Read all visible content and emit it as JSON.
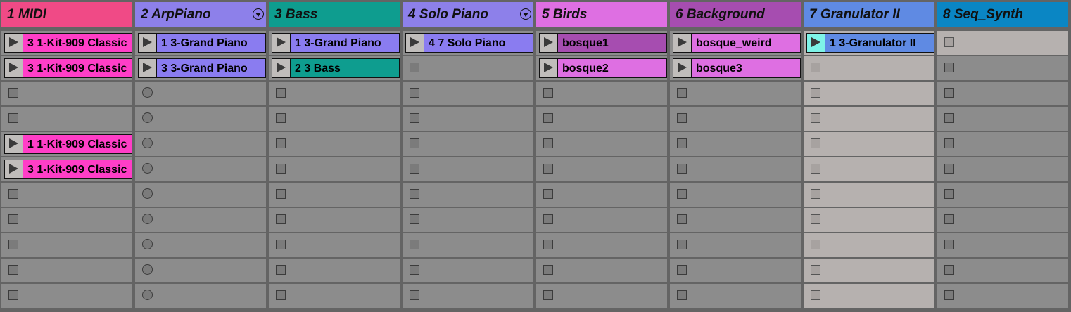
{
  "session": {
    "tracks": [
      {
        "name": "1 MIDI",
        "color": "#f04a86",
        "slot_bg": "dark",
        "fold_icon": false,
        "slots": [
          {
            "kind": "clip",
            "name": "3 1-Kit-909 Classic",
            "color": "#ff3ec7"
          },
          {
            "kind": "clip",
            "name": "3 1-Kit-909 Classic",
            "color": "#ff3ec7"
          },
          {
            "kind": "stop"
          },
          {
            "kind": "stop"
          },
          {
            "kind": "clip",
            "name": "1 1-Kit-909 Classic",
            "color": "#ff3ec7"
          },
          {
            "kind": "clip",
            "name": "3 1-Kit-909 Classic",
            "color": "#ff3ec7"
          },
          {
            "kind": "stop"
          },
          {
            "kind": "stop"
          },
          {
            "kind": "stop"
          },
          {
            "kind": "stop"
          },
          {
            "kind": "stop"
          }
        ]
      },
      {
        "name": "2 ArpPiano",
        "color": "#8d80ea",
        "slot_bg": "dark",
        "fold_icon": true,
        "slots": [
          {
            "kind": "clip",
            "name": "1 3-Grand Piano",
            "color": "#8a7cf0"
          },
          {
            "kind": "clip",
            "name": "3 3-Grand Piano",
            "color": "#8a7cf0"
          },
          {
            "kind": "rec"
          },
          {
            "kind": "rec"
          },
          {
            "kind": "rec"
          },
          {
            "kind": "rec"
          },
          {
            "kind": "rec"
          },
          {
            "kind": "rec"
          },
          {
            "kind": "rec"
          },
          {
            "kind": "rec"
          },
          {
            "kind": "rec"
          }
        ]
      },
      {
        "name": "3 Bass",
        "color": "#0e9d8f",
        "slot_bg": "dark",
        "fold_icon": false,
        "slots": [
          {
            "kind": "clip",
            "name": "1 3-Grand Piano",
            "color": "#8a7cf0"
          },
          {
            "kind": "clip",
            "name": "2 3 Bass",
            "color": "#0e9d8f"
          },
          {
            "kind": "stop"
          },
          {
            "kind": "stop"
          },
          {
            "kind": "stop"
          },
          {
            "kind": "stop"
          },
          {
            "kind": "stop"
          },
          {
            "kind": "stop"
          },
          {
            "kind": "stop"
          },
          {
            "kind": "stop"
          },
          {
            "kind": "stop"
          }
        ]
      },
      {
        "name": "4 Solo Piano",
        "color": "#8d80ea",
        "slot_bg": "dark",
        "fold_icon": true,
        "slots": [
          {
            "kind": "clip",
            "name": "4 7 Solo Piano",
            "color": "#8a7cf0"
          },
          {
            "kind": "stop"
          },
          {
            "kind": "stop"
          },
          {
            "kind": "stop"
          },
          {
            "kind": "stop"
          },
          {
            "kind": "stop"
          },
          {
            "kind": "stop"
          },
          {
            "kind": "stop"
          },
          {
            "kind": "stop"
          },
          {
            "kind": "stop"
          },
          {
            "kind": "stop"
          }
        ]
      },
      {
        "name": "5 Birds",
        "color": "#de6fe2",
        "slot_bg": "dark",
        "fold_icon": false,
        "slots": [
          {
            "kind": "clip",
            "name": "bosque1",
            "color": "#a64db0"
          },
          {
            "kind": "clip",
            "name": "bosque2",
            "color": "#de6fe2"
          },
          {
            "kind": "stop"
          },
          {
            "kind": "stop"
          },
          {
            "kind": "stop"
          },
          {
            "kind": "stop"
          },
          {
            "kind": "stop"
          },
          {
            "kind": "stop"
          },
          {
            "kind": "stop"
          },
          {
            "kind": "stop"
          },
          {
            "kind": "stop"
          }
        ]
      },
      {
        "name": "6 Background",
        "color": "#a64db0",
        "slot_bg": "dark",
        "fold_icon": false,
        "slots": [
          {
            "kind": "clip",
            "name": "bosque_weird",
            "color": "#de6fe2"
          },
          {
            "kind": "clip",
            "name": "bosque3",
            "color": "#de6fe2"
          },
          {
            "kind": "stop"
          },
          {
            "kind": "stop"
          },
          {
            "kind": "stop"
          },
          {
            "kind": "stop"
          },
          {
            "kind": "stop"
          },
          {
            "kind": "stop"
          },
          {
            "kind": "stop"
          },
          {
            "kind": "stop"
          },
          {
            "kind": "stop"
          }
        ]
      },
      {
        "name": "7 Granulator II",
        "color": "#5f8ae3",
        "slot_bg": "light",
        "fold_icon": false,
        "slots": [
          {
            "kind": "clip",
            "name": "1 3-Granulator II",
            "color": "#5f8ae3",
            "playing": true
          },
          {
            "kind": "stop"
          },
          {
            "kind": "stop"
          },
          {
            "kind": "stop"
          },
          {
            "kind": "stop"
          },
          {
            "kind": "stop"
          },
          {
            "kind": "stop"
          },
          {
            "kind": "stop"
          },
          {
            "kind": "stop"
          },
          {
            "kind": "stop"
          },
          {
            "kind": "stop"
          }
        ]
      },
      {
        "name": "8 Seq_Synth",
        "color": "#0a86c4",
        "slot_bg": "mixed",
        "fold_icon": false,
        "slots": [
          {
            "kind": "stop",
            "light": true
          },
          {
            "kind": "stop"
          },
          {
            "kind": "stop"
          },
          {
            "kind": "stop"
          },
          {
            "kind": "stop"
          },
          {
            "kind": "stop"
          },
          {
            "kind": "stop"
          },
          {
            "kind": "stop"
          },
          {
            "kind": "stop"
          },
          {
            "kind": "stop"
          },
          {
            "kind": "stop"
          }
        ]
      }
    ],
    "icons": {
      "clip_launch": "play-triangle-icon",
      "slot_stop": "stop-square-icon",
      "slot_record": "record-circle-icon",
      "track_fold": "fold-chevron-icon"
    },
    "playing_highlight_color": "#7ef3e8"
  }
}
